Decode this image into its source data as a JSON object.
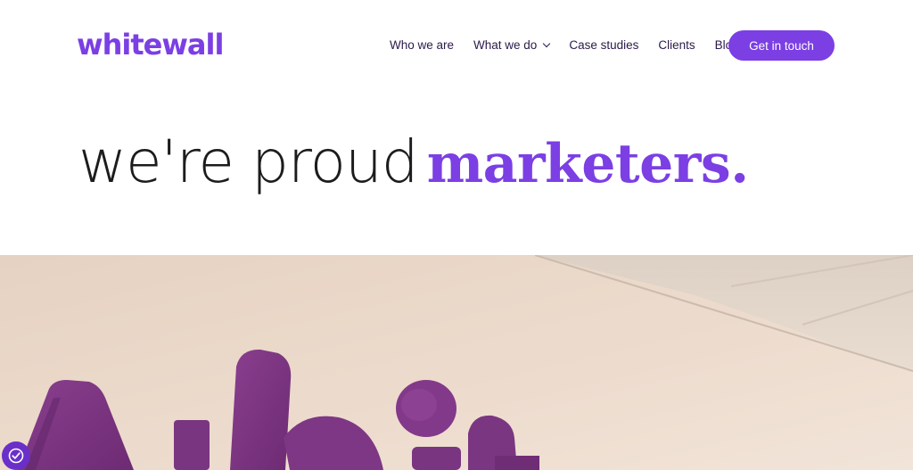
{
  "brand": {
    "logo_text": "whitewall",
    "accent_color": "#7b3fe4"
  },
  "nav": {
    "items": [
      {
        "label": "Who we are",
        "has_dropdown": false
      },
      {
        "label": "What we do",
        "has_dropdown": true
      },
      {
        "label": "Case studies",
        "has_dropdown": false
      },
      {
        "label": "Clients",
        "has_dropdown": false
      },
      {
        "label": "Blog",
        "has_dropdown": false
      }
    ],
    "cta_label": "Get in touch"
  },
  "hero": {
    "title_light": "we're proud",
    "title_bold": "marketers."
  },
  "accessibility": {
    "icon": "accessibility-icon"
  }
}
